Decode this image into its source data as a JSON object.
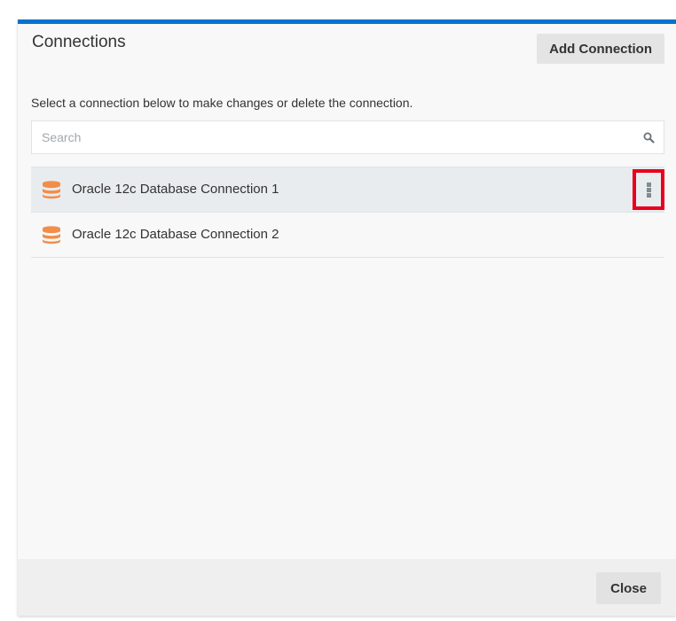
{
  "dialog": {
    "title": "Connections",
    "add_button_label": "Add Connection",
    "description": "Select a connection below to make changes or delete the connection.",
    "close_button_label": "Close"
  },
  "search": {
    "placeholder": "Search",
    "value": "",
    "icon": "search-icon"
  },
  "connections": [
    {
      "label": "Oracle 12c Database Connection 1",
      "icon": "database-icon",
      "selected": true,
      "menu_icon": "kebab-menu-icon"
    },
    {
      "label": "Oracle 12c Database Connection 2",
      "icon": "database-icon",
      "selected": false
    }
  ],
  "colors": {
    "accent": "#0572ce",
    "database_icon": "#f08e4a",
    "highlight_box": "#e8001c"
  }
}
